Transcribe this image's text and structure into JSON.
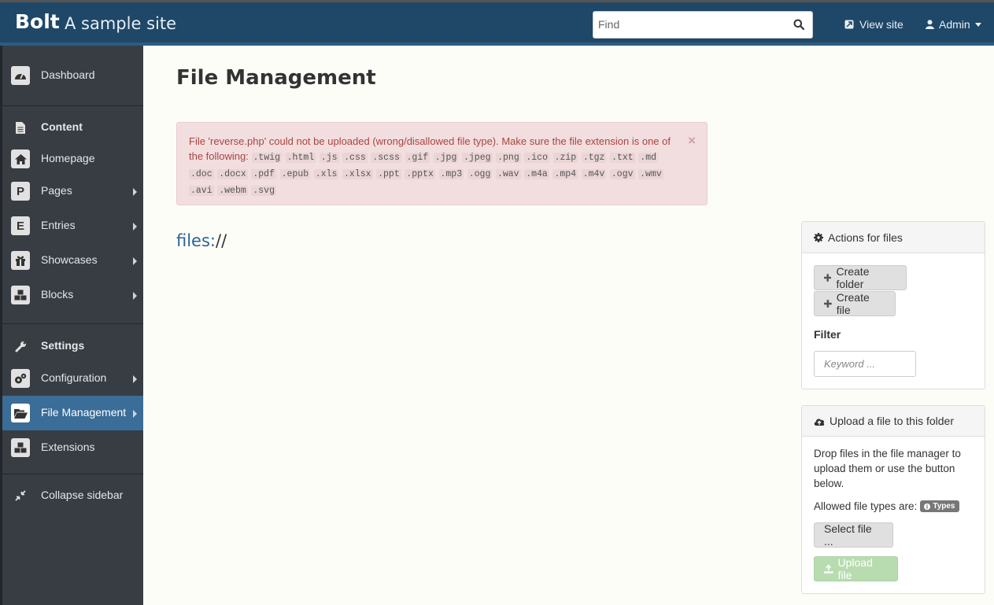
{
  "header": {
    "brand": "Bolt",
    "site_name": "A sample site",
    "search_placeholder": "Find",
    "view_site": "View site",
    "admin": "Admin"
  },
  "sidebar": {
    "dashboard": "Dashboard",
    "content_header": "Content",
    "homepage": "Homepage",
    "pages": "Pages",
    "pages_icon_letter": "P",
    "entries": "Entries",
    "entries_icon_letter": "E",
    "showcases": "Showcases",
    "blocks": "Blocks",
    "settings_header": "Settings",
    "configuration": "Configuration",
    "file_management": "File Management",
    "extensions": "Extensions",
    "collapse": "Collapse sidebar"
  },
  "main": {
    "title": "File Management",
    "alert": {
      "message": "File 'reverse.php' could not be uploaded (wrong/disallowed file type). Make sure the file extension is one of the following:",
      "extensions": [
        ".twig",
        ".html",
        ".js",
        ".css",
        ".scss",
        ".gif",
        ".jpg",
        ".jpeg",
        ".png",
        ".ico",
        ".zip",
        ".tgz",
        ".txt",
        ".md",
        ".doc",
        ".docx",
        ".pdf",
        ".epub",
        ".xls",
        ".xlsx",
        ".ppt",
        ".pptx",
        ".mp3",
        ".ogg",
        ".wav",
        ".m4a",
        ".mp4",
        ".m4v",
        ".ogv",
        ".wmv",
        ".avi",
        ".webm",
        ".svg"
      ],
      "close": "×"
    },
    "path_proto": "files:",
    "path_sep": "//"
  },
  "actions_panel": {
    "title": "Actions for files",
    "create_folder": "Create folder",
    "create_file": "Create file",
    "filter_label": "Filter",
    "filter_placeholder": "Keyword ..."
  },
  "upload_panel": {
    "title": "Upload a file to this folder",
    "description": "Drop files in the file manager to upload them or use the button below.",
    "allowed_label": "Allowed file types are:",
    "types_badge": "Types",
    "select_file": "Select file ...",
    "upload_file": "Upload file"
  }
}
